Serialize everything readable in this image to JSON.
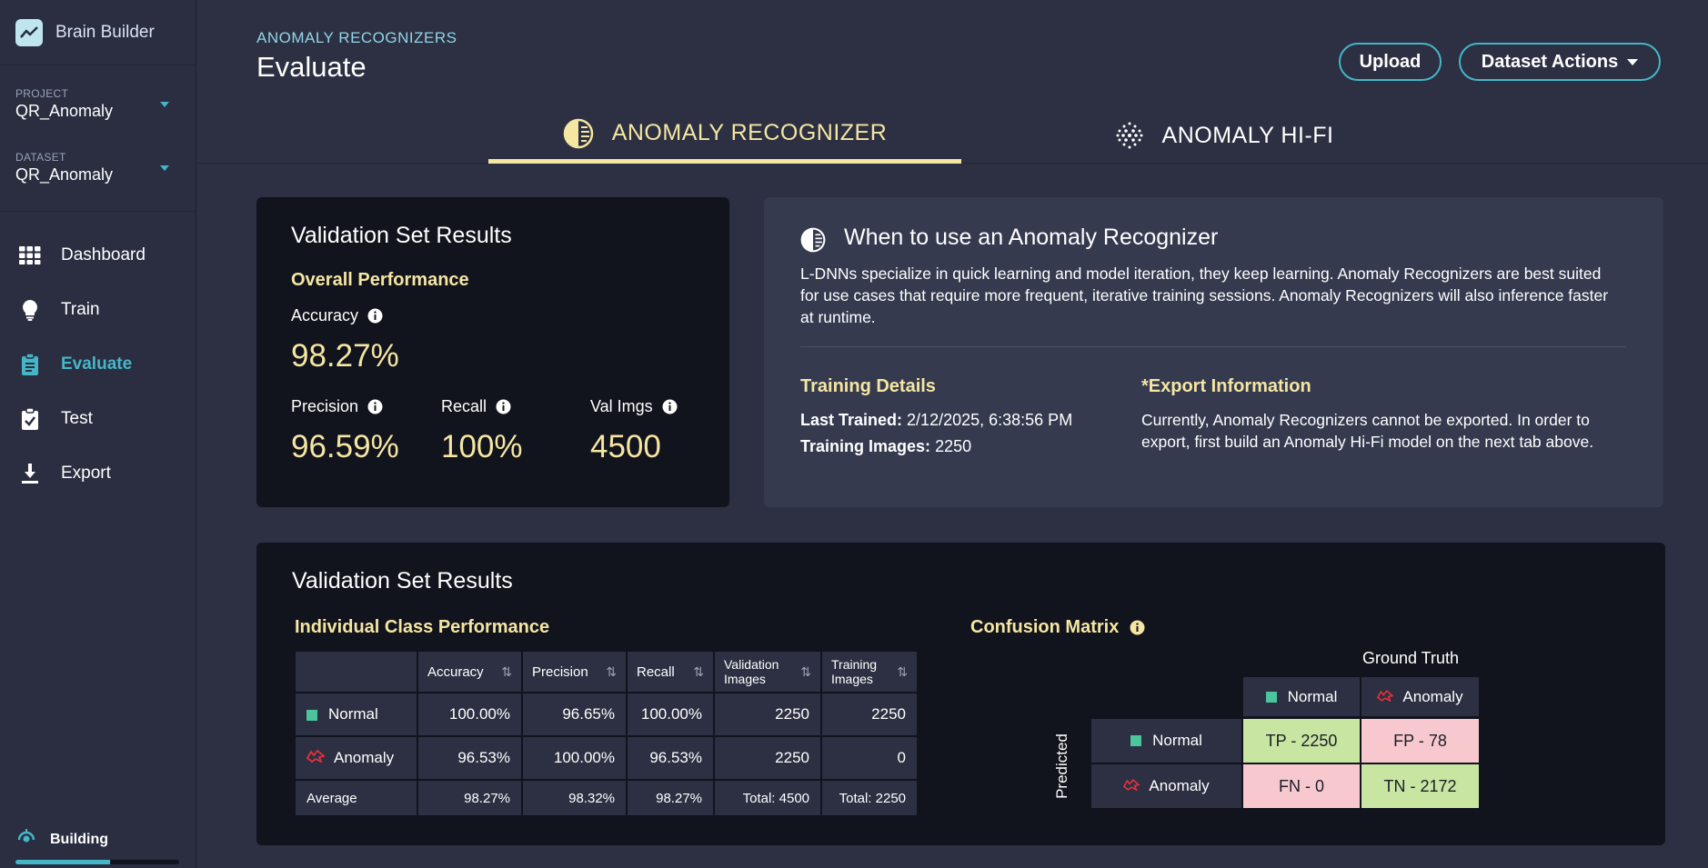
{
  "app": {
    "name": "Brain Builder"
  },
  "sidebar": {
    "project": {
      "label": "PROJECT",
      "value": "QR_Anomaly"
    },
    "dataset": {
      "label": "DATASET",
      "value": "QR_Anomaly"
    },
    "nav": [
      {
        "label": "Dashboard",
        "icon": "grid-icon"
      },
      {
        "label": "Train",
        "icon": "lightbulb-icon"
      },
      {
        "label": "Evaluate",
        "icon": "clipboard-icon",
        "active": true
      },
      {
        "label": "Test",
        "icon": "clipboard-check-icon"
      },
      {
        "label": "Export",
        "icon": "download-icon"
      }
    ],
    "status": {
      "label": "Building",
      "progress": 0.58
    }
  },
  "header": {
    "breadcrumb": "ANOMALY RECOGNIZERS",
    "title": "Evaluate",
    "upload_label": "Upload",
    "dataset_actions_label": "Dataset Actions",
    "tabs": [
      {
        "label": "ANOMALY RECOGNIZER",
        "active": true
      },
      {
        "label": "ANOMALY HI-FI",
        "active": false
      }
    ]
  },
  "validation": {
    "title": "Validation Set Results",
    "overall": "Overall Performance",
    "accuracy": {
      "label": "Accuracy",
      "value": "98.27%"
    },
    "precision": {
      "label": "Precision",
      "value": "96.59%"
    },
    "recall": {
      "label": "Recall",
      "value": "100%"
    },
    "val_imgs": {
      "label": "Val Imgs",
      "value": "4500"
    }
  },
  "when": {
    "title": "When to use an Anomaly Recognizer",
    "description": "L-DNNs specialize in quick learning and model iteration, they keep learning. Anomaly Recognizers are best suited for use cases that require more frequent, iterative training sessions. Anomaly Recognizers will also inference faster at runtime.",
    "training_details": {
      "title": "Training Details",
      "last_trained_label": "Last Trained:",
      "last_trained_value": "2/12/2025, 6:38:56 PM",
      "images_label": "Training Images:",
      "images_value": "2250"
    },
    "export_info": {
      "title": "*Export Information",
      "text": "Currently, Anomaly Recognizers cannot be exported. In order to export, first build an Anomaly Hi-Fi model on the next tab above."
    }
  },
  "results": {
    "title": "Validation Set Results",
    "class_perf_title": "Individual Class Performance",
    "columns": [
      "Accuracy",
      "Precision",
      "Recall",
      "Validation Images",
      "Training Images"
    ],
    "rows": [
      {
        "name": "Normal",
        "accuracy": "100.00%",
        "precision": "96.65%",
        "recall": "100.00%",
        "validation": "2250",
        "training": "2250"
      },
      {
        "name": "Anomaly",
        "accuracy": "96.53%",
        "precision": "100.00%",
        "recall": "96.53%",
        "validation": "2250",
        "training": "0"
      }
    ],
    "average": {
      "name": "Average",
      "accuracy": "98.27%",
      "precision": "98.32%",
      "recall": "98.27%",
      "validation": "Total: 4500",
      "training": "Total: 2250"
    },
    "confusion": {
      "title": "Confusion Matrix",
      "ground_truth": "Ground Truth",
      "predicted": "Predicted",
      "classes": [
        "Normal",
        "Anomaly"
      ],
      "tp": "TP - 2250",
      "fp": "FP - 78",
      "fn": "FN - 0",
      "tn": "TN - 2172"
    }
  },
  "colors": {
    "accent": "#45b6c8",
    "highlight": "#f5e6a2",
    "normal": "#4cc59d",
    "anomaly": "#e0323c",
    "cell_correct": "#c9e5a2",
    "cell_wrong": "#f7c9cf"
  }
}
